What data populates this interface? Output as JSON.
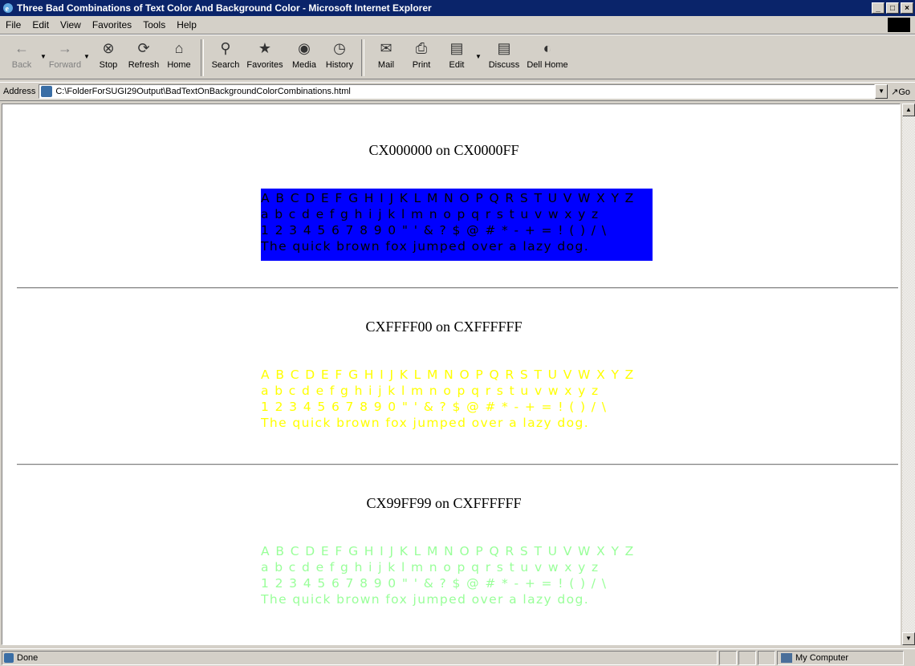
{
  "window": {
    "title": "Three Bad Combinations of Text Color And Background Color - Microsoft Internet Explorer",
    "buttons": [
      "_",
      "□",
      "×"
    ]
  },
  "menubar": {
    "items": [
      {
        "label": "File"
      },
      {
        "label": "Edit"
      },
      {
        "label": "View"
      },
      {
        "label": "Favorites"
      },
      {
        "label": "Tools"
      },
      {
        "label": "Help"
      }
    ]
  },
  "toolbar": {
    "back": {
      "label": "Back",
      "icon": "back-arrow-icon"
    },
    "forward": {
      "label": "Forward",
      "icon": "forward-arrow-icon"
    },
    "stop": {
      "label": "Stop",
      "icon": "stop-icon"
    },
    "refresh": {
      "label": "Refresh",
      "icon": "refresh-icon"
    },
    "home": {
      "label": "Home",
      "icon": "home-icon"
    },
    "search": {
      "label": "Search",
      "icon": "search-icon"
    },
    "favorites": {
      "label": "Favorites",
      "icon": "favorites-icon"
    },
    "media": {
      "label": "Media",
      "icon": "media-icon"
    },
    "history": {
      "label": "History",
      "icon": "history-icon"
    },
    "mail": {
      "label": "Mail",
      "icon": "mail-icon"
    },
    "print": {
      "label": "Print",
      "icon": "print-icon"
    },
    "edit": {
      "label": "Edit",
      "icon": "edit-icon"
    },
    "discuss": {
      "label": "Discuss",
      "icon": "discuss-icon"
    },
    "dellhome": {
      "label": "Dell Home",
      "icon": "dell-home-icon"
    }
  },
  "address": {
    "label": "Address",
    "value": "C:\\FolderForSUGI29Output\\BadTextOnBackgroundColorCombinations.html",
    "go_label": "Go"
  },
  "content": {
    "sections": [
      {
        "title": "CX000000 on CX0000FF",
        "text_color": "#000000",
        "bg_color": "#0000FF",
        "lines": [
          "A B C D E F G H I J K L M N O P Q R S T U V W X Y Z",
          "a b c d e f g h i j k l m n o p q r s t u v w x y z",
          "1 2 3 4 5 6 7 8 9 0 \" ' & ? $ @ # * - + = ! ( ) / \\",
          "The quick brown fox jumped over a lazy dog."
        ]
      },
      {
        "title": "CXFFFF00 on CXFFFFFF",
        "text_color": "#FFFF00",
        "bg_color": "#FFFFFF",
        "lines": [
          "A B C D E F G H I J K L M N O P Q R S T U V W X Y Z",
          "a b c d e f g h i j k l m n o p q r s t u v w x y z",
          "1 2 3 4 5 6 7 8 9 0 \" ' & ? $ @ # * - + = ! ( ) / \\",
          "The quick brown fox jumped over a lazy dog."
        ]
      },
      {
        "title": "CX99FF99 on CXFFFFFF",
        "text_color": "#99FF99",
        "bg_color": "#FFFFFF",
        "lines": [
          "A B C D E F G H I J K L M N O P Q R S T U V W X Y Z",
          "a b c d e f g h i j k l m n o p q r s t u v w x y z",
          "1 2 3 4 5 6 7 8 9 0 \" ' & ? $ @ # * - + = ! ( ) / \\",
          "The quick brown fox jumped over a lazy dog."
        ]
      }
    ]
  },
  "statusbar": {
    "status": "Done",
    "zone": "My Computer"
  }
}
